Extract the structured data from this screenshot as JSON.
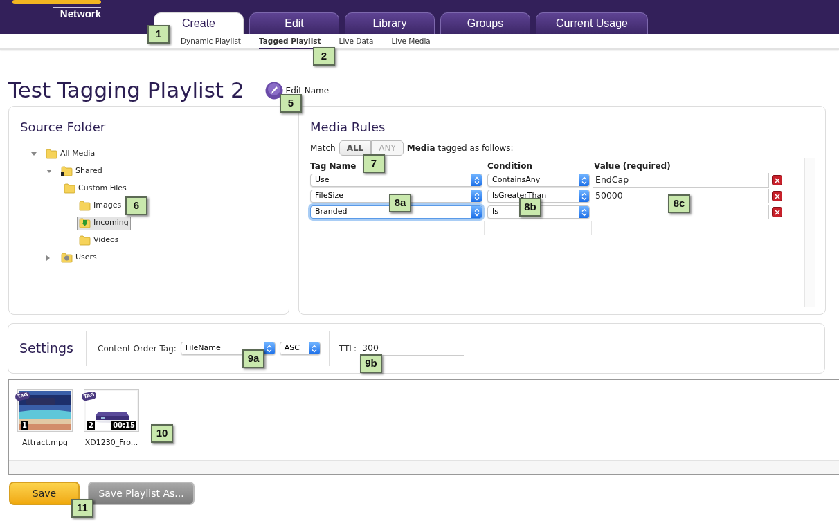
{
  "header": {
    "logo_text": "Network",
    "tabs": [
      {
        "label": "Create",
        "selected": true
      },
      {
        "label": "Edit",
        "selected": false
      },
      {
        "label": "Library",
        "selected": false
      },
      {
        "label": "Groups",
        "selected": false
      },
      {
        "label": "Current Usage",
        "selected": false
      }
    ]
  },
  "subnav": [
    {
      "label": "Dynamic Playlist",
      "selected": false
    },
    {
      "label": "Tagged Playlist",
      "selected": true
    },
    {
      "label": "Live Data",
      "selected": false
    },
    {
      "label": "Live Media",
      "selected": false
    }
  ],
  "page_title": "Test Tagging Playlist 2",
  "edit_name": "Edit Name",
  "source_folder": {
    "title": "Source Folder",
    "tree": [
      {
        "label": "All Media",
        "kind": "folder",
        "expanded": true,
        "selected": false,
        "children": [
          {
            "label": "Shared",
            "kind": "shared",
            "expanded": true,
            "selected": false,
            "children": [
              {
                "label": "Custom Files",
                "kind": "folder",
                "selected": false,
                "children": [
                  {
                    "label": "Images",
                    "kind": "folder",
                    "selected": false
                  },
                  {
                    "label": "Incoming",
                    "kind": "download",
                    "selected": true
                  },
                  {
                    "label": "Videos",
                    "kind": "folder",
                    "selected": false
                  }
                ]
              }
            ]
          },
          {
            "label": "Users",
            "kind": "users",
            "expanded": false,
            "selected": false
          }
        ]
      }
    ]
  },
  "media_rules": {
    "title": "Media Rules",
    "match_label": "Match",
    "match_options": [
      {
        "label": "ALL",
        "selected": true
      },
      {
        "label": "ANY",
        "selected": false
      }
    ],
    "description": "**Media** tagged as follows:",
    "columns": [
      "Tag Name",
      "Condition",
      "Value (required)"
    ],
    "rules": [
      {
        "tag": "Use",
        "condition": "ContainsAny",
        "value": "EndCap",
        "focused": false
      },
      {
        "tag": "FileSize",
        "condition": "IsGreaterThan",
        "value": "50000",
        "focused": false
      },
      {
        "tag": "Branded",
        "condition": "Is",
        "focused": true
      }
    ]
  },
  "settings": {
    "title": "Settings",
    "order_label": "Content Order Tag:",
    "order_tag": "FileName",
    "order_direction": "ASC",
    "ttl_label": "TTL:",
    "ttl": "300"
  },
  "media": [
    {
      "name": "Attract.mpg",
      "index": "1",
      "tag": "TAG",
      "kind": "picture"
    },
    {
      "name": "XD1230_Fro...",
      "index": "2",
      "duration": "00:15",
      "tag": "TAG",
      "kind": "picture"
    }
  ],
  "buttons": [
    {
      "label": "Save",
      "kind": "primary"
    },
    {
      "label": "Save Playlist As...",
      "kind": "secondary"
    }
  ],
  "callouts": [
    "1",
    "2",
    "5",
    "6",
    "7",
    "8a",
    "8b",
    "8c",
    "9a",
    "9b",
    "10",
    "11"
  ]
}
